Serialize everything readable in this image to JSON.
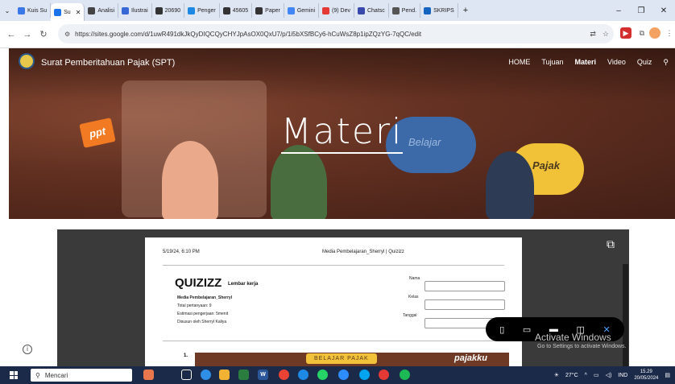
{
  "browser": {
    "tabs": [
      {
        "label": "Kuis Su",
        "color": "#3b78e7"
      },
      {
        "label": "Su",
        "color": "#1a73e8",
        "active": true
      },
      {
        "label": "Analisi",
        "color": "#444444"
      },
      {
        "label": "Ilustrai",
        "color": "#3867d6"
      },
      {
        "label": "20690",
        "color": "#333333"
      },
      {
        "label": "Penger",
        "color": "#1e88e5"
      },
      {
        "label": "45605",
        "color": "#333333"
      },
      {
        "label": "Paper",
        "color": "#333333"
      },
      {
        "label": "Gemini",
        "color": "#4285f4"
      },
      {
        "label": "(9) Dev",
        "color": "#e53935"
      },
      {
        "label": "Chatsc",
        "color": "#3949ab"
      },
      {
        "label": "Pend.",
        "color": "#555555"
      },
      {
        "label": "SKRIPS",
        "color": "#1565c0"
      }
    ],
    "new_tab": "+",
    "minimize": "–",
    "maximize": "❐",
    "close": "✕",
    "url": "https://sites.google.com/d/1uwR491dkJkQyDIQCQyCHYJpAsOX0QxU7/p/1i5bXSfBCy6-hCuWsZ8p1ipZQzYG-7qQC/edit"
  },
  "site": {
    "title": "Surat Pemberitahuan Pajak (SPT)",
    "nav": [
      "HOME",
      "Tujuan",
      "Materi",
      "Video",
      "Quiz"
    ],
    "active_nav": "Materi",
    "hero_title": "Materi",
    "bubble_blue": "Belajar",
    "bubble_yellow": "Pajak",
    "ppt_label": "ppt"
  },
  "document": {
    "header_left": "5/19/24, 6:10 PM",
    "header_center": "Media Pembelajaran_Sherryl | Quizizz",
    "logo": "QUIZIZZ",
    "logo_sub": "Lembar kerja",
    "info": {
      "name": "Media Pembelajaran_Sherryl",
      "total": "Total pertanyaan: 9",
      "estimate": "Estimasi pengerjaan: 5menit",
      "author": "Disusun oleh Sherryl Kaliya"
    },
    "fields": [
      "Nama",
      "Kelas",
      "Tanggal"
    ],
    "question_number": "1.",
    "banner_label": "BELAJAR PAJAK",
    "banner_brand": "pajakku"
  },
  "overlay": {
    "activate_title": "Activate Windows",
    "activate_sub": "Go to Settings to activate Windows."
  },
  "taskbar": {
    "search_placeholder": "Mencari",
    "temperature": "27°C",
    "language": "IND",
    "time": "15.29",
    "date": "20/05/2024"
  }
}
